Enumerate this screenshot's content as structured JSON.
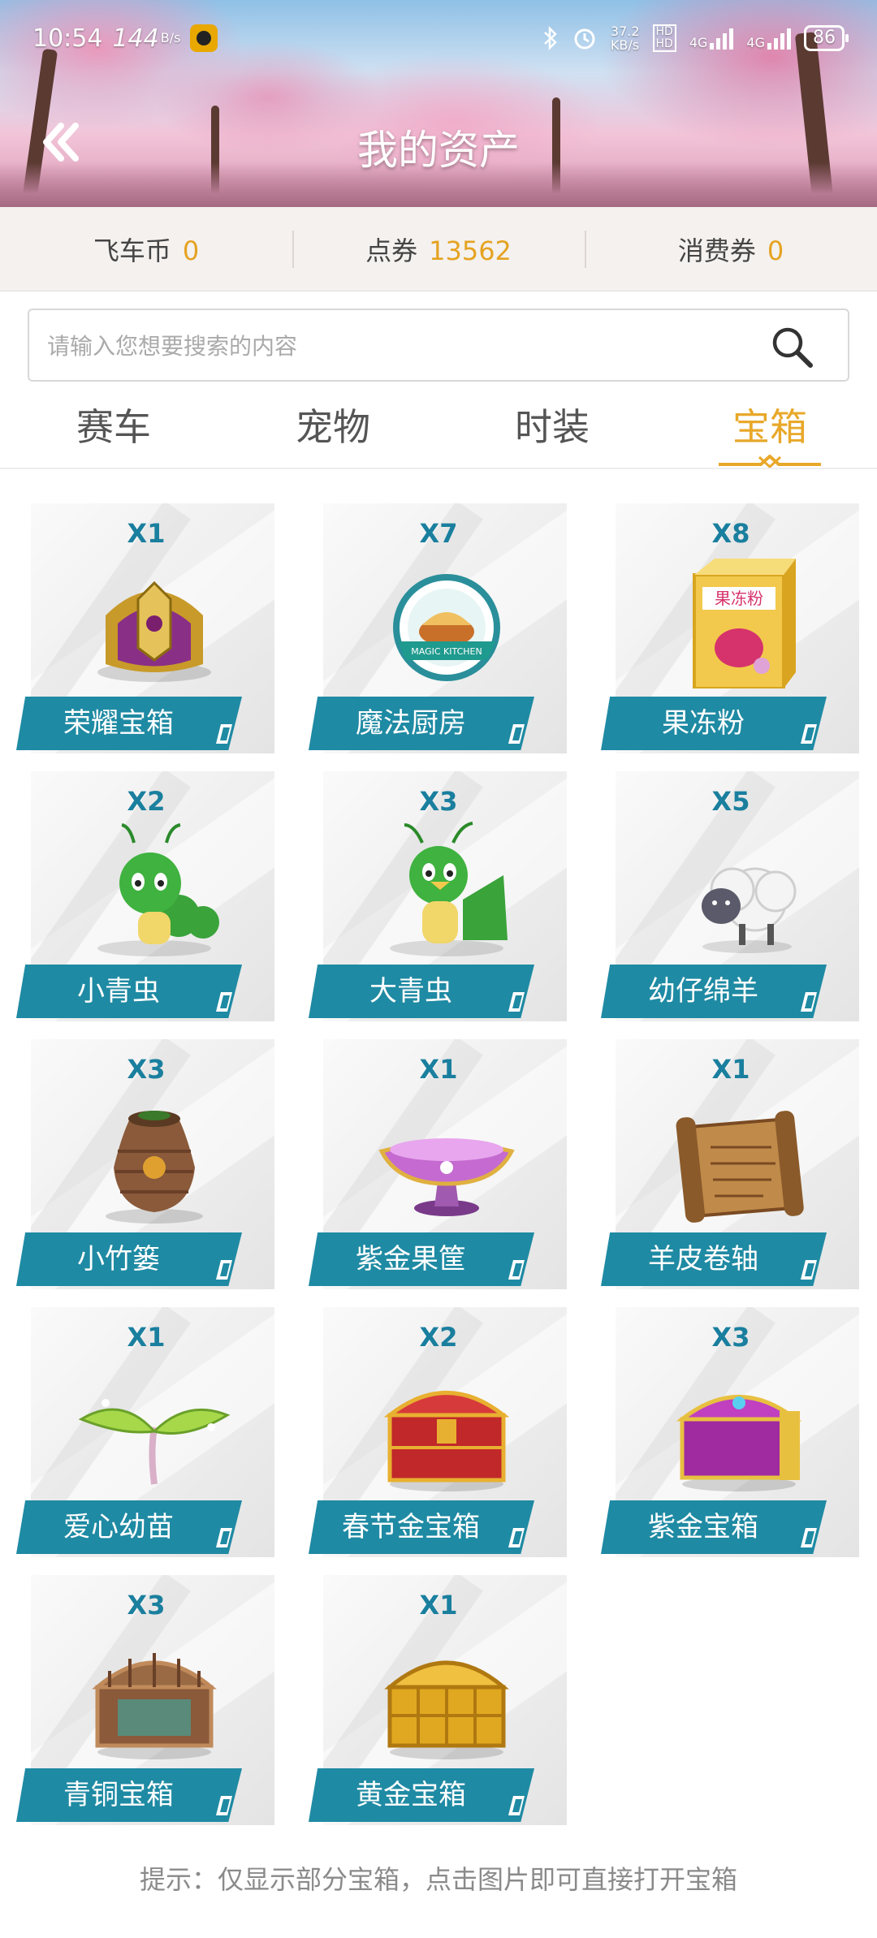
{
  "status_bar": {
    "time": "10:54",
    "speed_left": "144",
    "speed_left_unit": "B/s",
    "net_speed": "37.2",
    "net_speed_unit": "KB/s",
    "hd1": "HD",
    "hd2": "HD",
    "net1": "4G",
    "net2": "4G",
    "battery": "86"
  },
  "header": {
    "title": "我的资产"
  },
  "balances": [
    {
      "label": "飞车币",
      "value": "0"
    },
    {
      "label": "点券",
      "value": "13562"
    },
    {
      "label": "消费券",
      "value": "0"
    }
  ],
  "search": {
    "placeholder": "请输入您想要搜索的内容",
    "value": ""
  },
  "tabs": [
    {
      "label": "赛车",
      "active": false
    },
    {
      "label": "宠物",
      "active": false
    },
    {
      "label": "时装",
      "active": false
    },
    {
      "label": "宝箱",
      "active": true
    }
  ],
  "colors": {
    "accent": "#e8a82a",
    "label_bg": "#1f8aa3",
    "qty": "#1a7f9e"
  },
  "items": [
    {
      "name": "荣耀宝箱",
      "qty": "X1",
      "icon": "glory-chest-icon"
    },
    {
      "name": "魔法厨房",
      "qty": "X7",
      "icon": "magic-kitchen-icon"
    },
    {
      "name": "果冻粉",
      "qty": "X8",
      "icon": "jelly-powder-icon"
    },
    {
      "name": "小青虫",
      "qty": "X2",
      "icon": "small-caterpillar-icon"
    },
    {
      "name": "大青虫",
      "qty": "X3",
      "icon": "big-caterpillar-icon"
    },
    {
      "name": "幼仔绵羊",
      "qty": "X5",
      "icon": "lamb-icon"
    },
    {
      "name": "小竹篓",
      "qty": "X3",
      "icon": "bamboo-basket-icon"
    },
    {
      "name": "紫金果筐",
      "qty": "X1",
      "icon": "purple-gold-fruit-bowl-icon"
    },
    {
      "name": "羊皮卷轴",
      "qty": "X1",
      "icon": "parchment-scroll-icon"
    },
    {
      "name": "爱心幼苗",
      "qty": "X1",
      "icon": "sprout-icon"
    },
    {
      "name": "春节金宝箱",
      "qty": "X2",
      "icon": "spring-festival-chest-icon"
    },
    {
      "name": "紫金宝箱",
      "qty": "X3",
      "icon": "purple-gold-chest-icon"
    },
    {
      "name": "青铜宝箱",
      "qty": "X3",
      "icon": "bronze-chest-icon"
    },
    {
      "name": "黄金宝箱",
      "qty": "X1",
      "icon": "gold-chest-icon"
    }
  ],
  "tip": "提示：仅显示部分宝箱，点击图片即可直接打开宝箱"
}
